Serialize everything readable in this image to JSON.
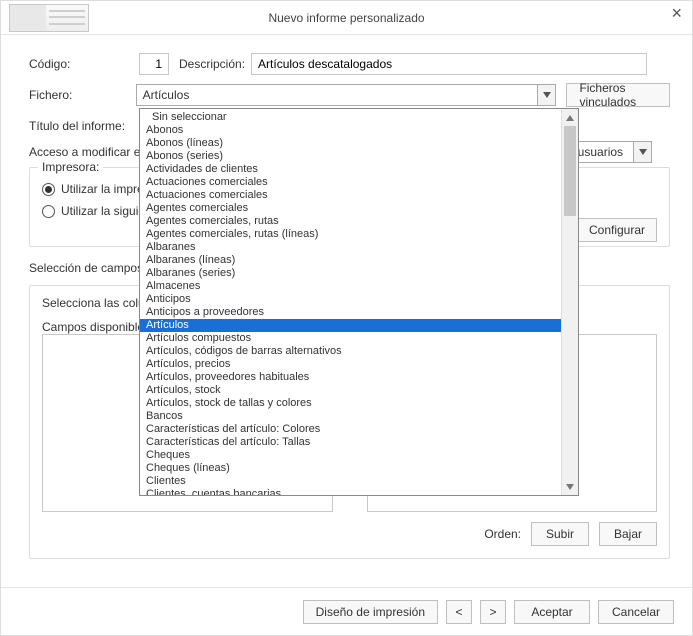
{
  "title": "Nuevo informe personalizado",
  "labels": {
    "codigo": "Código:",
    "descripcion": "Descripción:",
    "fichero": "Fichero:",
    "ficheros_vinculados": "Ficheros vinculados",
    "titulo_informe": "Título del informe:",
    "acceso": "Acceso a modificar el informe:",
    "acceso_value": "los usuarios",
    "impresora": "Impresora:",
    "radio_default": "Utilizar la impresora predeterminada",
    "radio_next": "Utilizar la siguiente impresora:",
    "configurar": "Configurar",
    "seleccion_header": "Selección de campos a mostrar en el informe",
    "selecciona_cols": "Selecciona las columnas que se incluirán en el informe de la lista de campos disponibles.",
    "campos_disponibles": "Campos disponibles:",
    "orden": "Orden:",
    "subir": "Subir",
    "bajar": "Bajar",
    "diseno": "Diseño de impresión",
    "prev": "<",
    "next": ">",
    "aceptar": "Aceptar",
    "cancelar": "Cancelar"
  },
  "values": {
    "codigo": "1",
    "descripcion": "Artículos descatalogados",
    "fichero": "Artículos",
    "titulo_informe": ""
  },
  "dropdown": {
    "selected_index": 16,
    "items": [
      "Sin seleccionar",
      "Abonos",
      "Abonos (líneas)",
      "Abonos (series)",
      "Actividades de clientes",
      "Actuaciones comerciales",
      "Actuaciones comerciales",
      "Agentes comerciales",
      "Agentes comerciales, rutas",
      "Agentes comerciales, rutas (líneas)",
      "Albaranes",
      "Albaranes (líneas)",
      "Albaranes (series)",
      "Almacenes",
      "Anticipos",
      "Anticipos a proveedores",
      "Artículos",
      "Artículos compuestos",
      "Artículos, códigos de barras alternativos",
      "Artículos, precios",
      "Artículos, proveedores habituales",
      "Artículos, stock",
      "Artículos, stock de tallas y colores",
      "Bancos",
      "Características del artículo: Colores",
      "Características del artículo: Tallas",
      "Cheques",
      "Cheques (líneas)",
      "Clientes",
      "Clientes, cuentas bancarias"
    ]
  }
}
